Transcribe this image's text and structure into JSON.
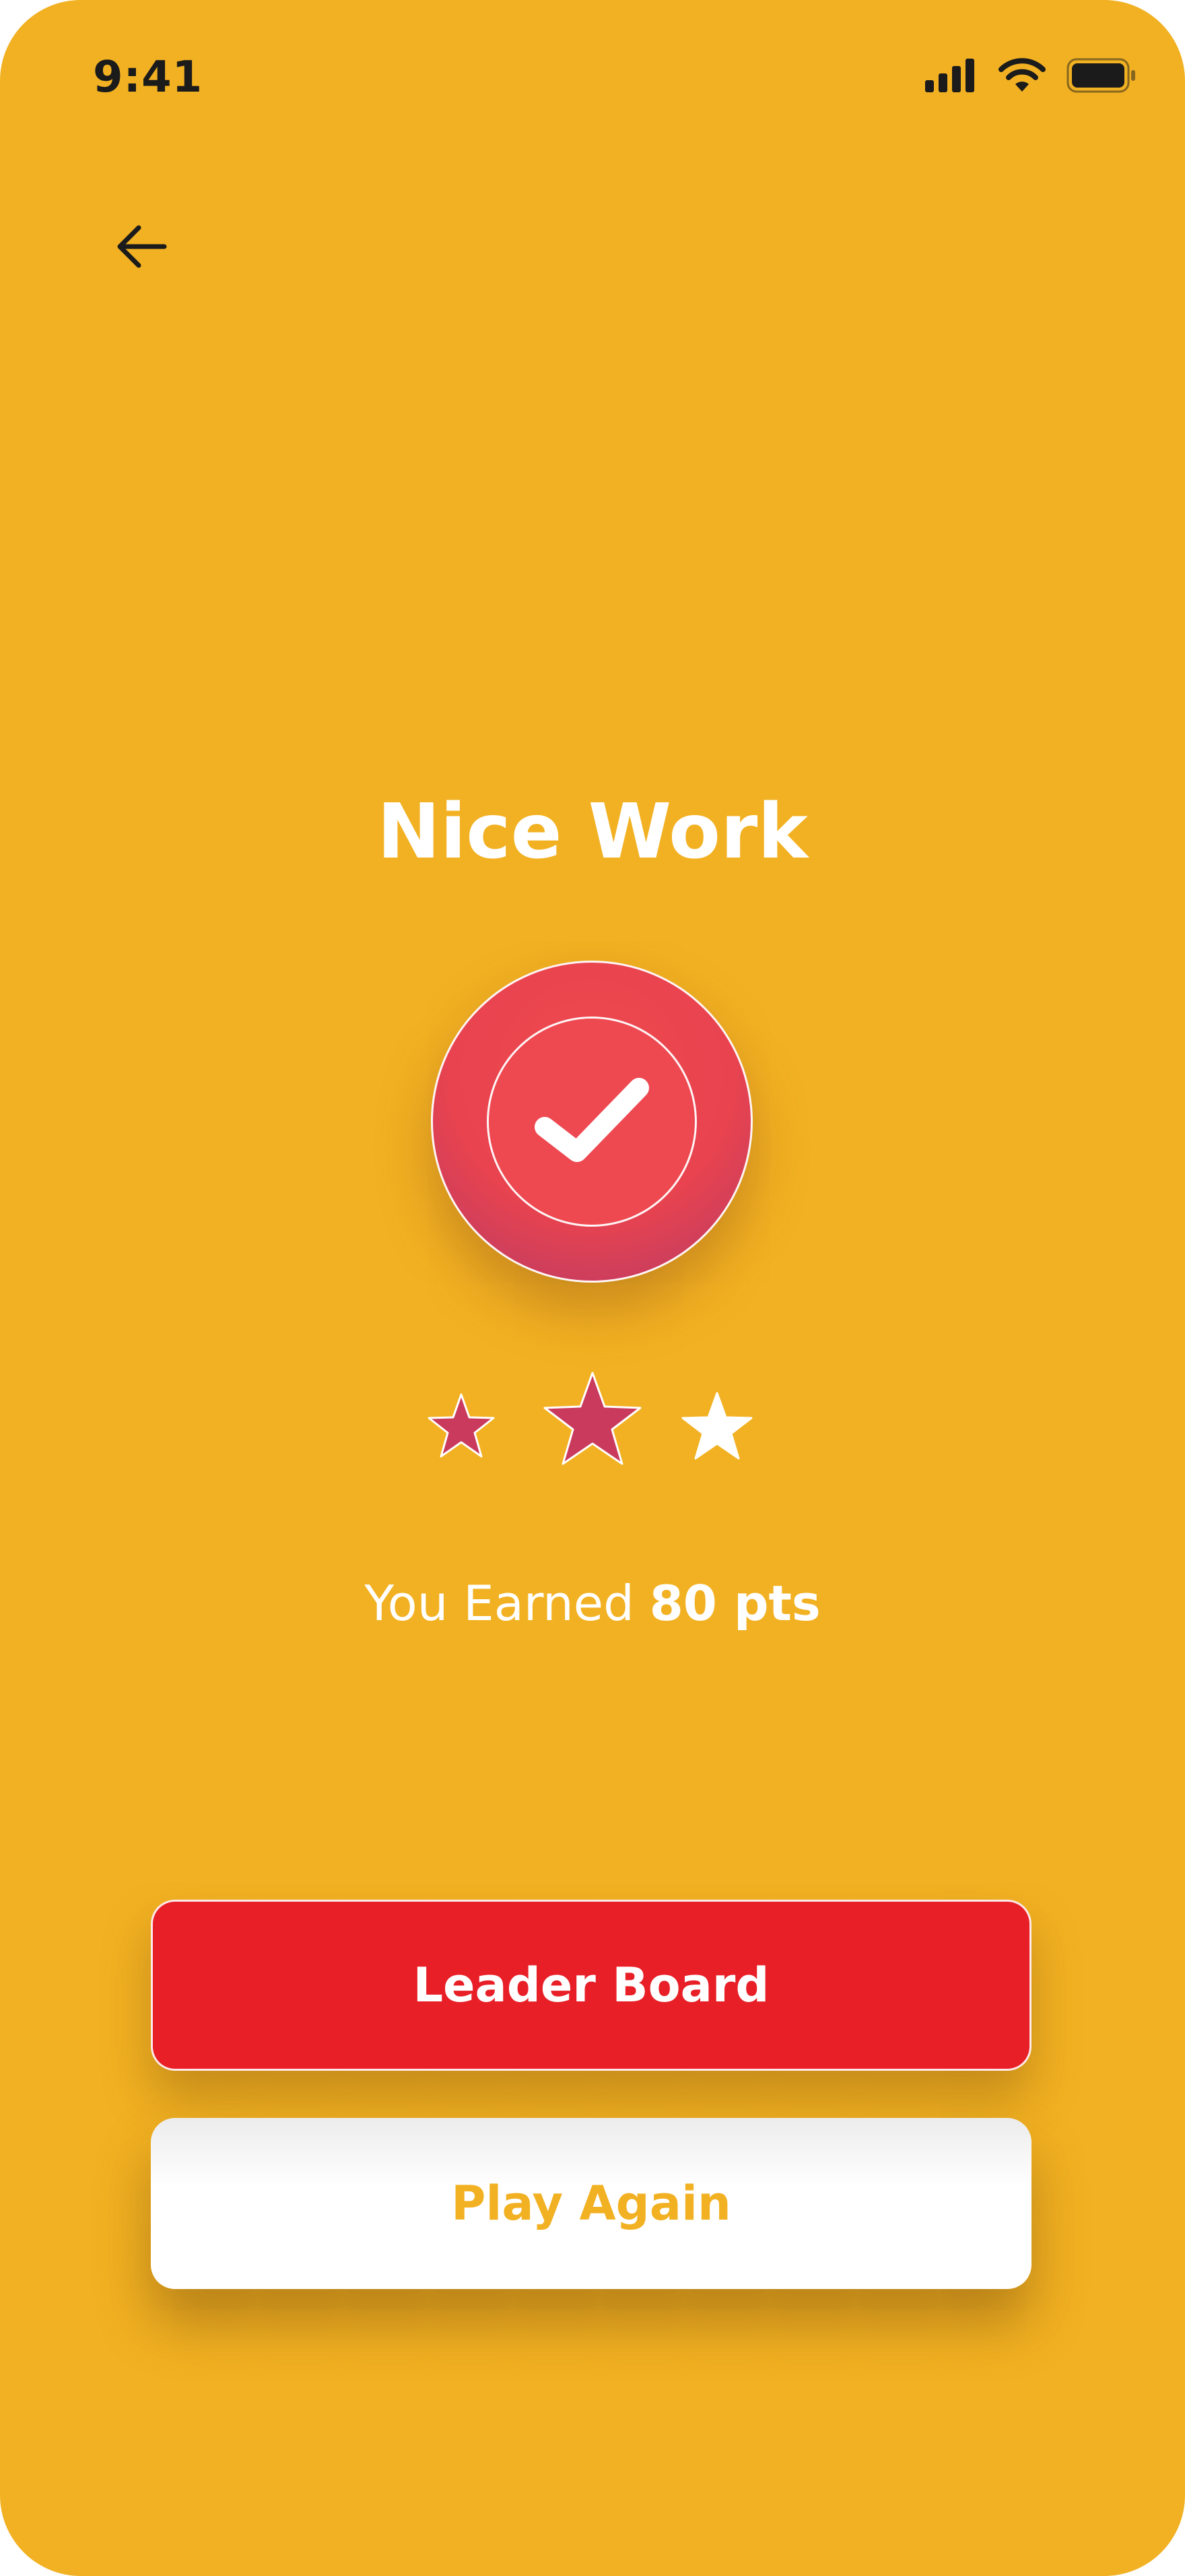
{
  "status_bar": {
    "time": "9:41"
  },
  "header": {
    "back_icon": "arrow-left-icon"
  },
  "result": {
    "title": "Nice Work",
    "badge_icon": "checkmark-icon",
    "rating": {
      "filled_stars": 2,
      "total_stars": 3
    },
    "earned_prefix": "You Earned",
    "earned_points": "80 pts"
  },
  "actions": {
    "leaderboard_label": "Leader Board",
    "play_again_label": "Play Again"
  },
  "colors": {
    "background": "#F2B122",
    "accent_red": "#E81F27",
    "badge_red": "#EE4850",
    "star_filled": "#C93A5C",
    "star_empty": "#FFFFFF"
  }
}
